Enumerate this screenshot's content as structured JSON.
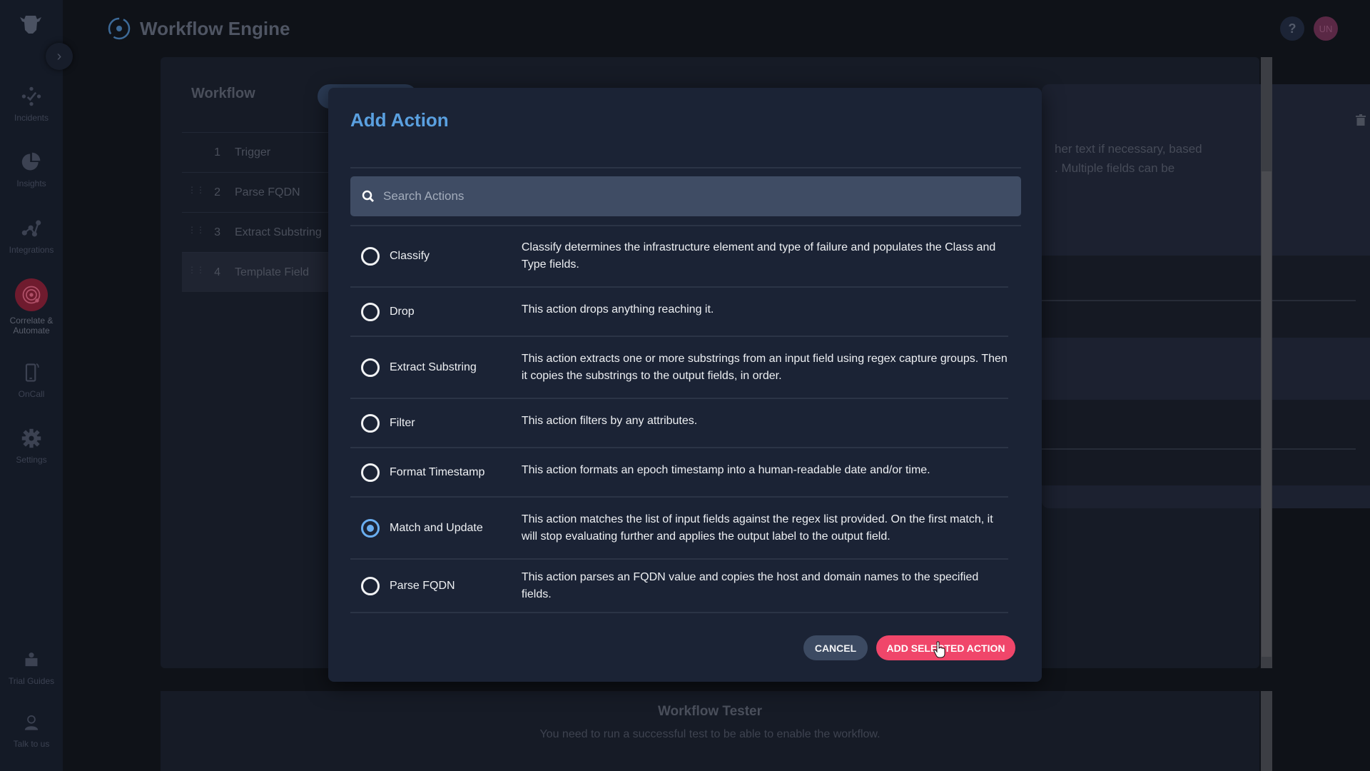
{
  "app": {
    "title": "Workflow Engine",
    "help_label": "?",
    "avatar_initials": "UN"
  },
  "sidebar": {
    "items": [
      {
        "label": "Incidents",
        "icon": "incidents-icon"
      },
      {
        "label": "Insights",
        "icon": "pie-chart-icon"
      },
      {
        "label": "Integrations",
        "icon": "integrations-icon"
      },
      {
        "label": "Correlate & Automate",
        "icon": "radar-icon",
        "active": true
      },
      {
        "label": "OnCall",
        "icon": "phone-icon"
      },
      {
        "label": "Settings",
        "icon": "gear-icon"
      },
      {
        "label": "Trial Guides",
        "icon": "book-icon"
      },
      {
        "label": "Talk to us",
        "icon": "support-agent-icon"
      }
    ]
  },
  "workflow": {
    "title": "Workflow",
    "steps": [
      {
        "num": "1",
        "label": "Trigger"
      },
      {
        "num": "2",
        "label": "Parse FQDN"
      },
      {
        "num": "3",
        "label": "Extract Substring"
      },
      {
        "num": "4",
        "label": "Template Field"
      }
    ],
    "detail_text_line1": "her text if necessary, based",
    "detail_text_line2": ". Multiple fields can be"
  },
  "tester": {
    "title": "Workflow Tester",
    "message": "You need to run a successful test to be able to enable the workflow."
  },
  "modal": {
    "title": "Add Action",
    "search_placeholder": "Search Actions",
    "search_value": "",
    "actions": [
      {
        "name": "Classify",
        "description": "Classify determines the infrastructure element and type of failure and populates the Class and Type fields.",
        "selected": false
      },
      {
        "name": "Drop",
        "description": "This action drops anything reaching it.",
        "selected": false
      },
      {
        "name": "Extract Substring",
        "description": "This action extracts one or more substrings from an input field using regex capture groups. Then it copies the substrings to the output fields, in order.",
        "selected": false
      },
      {
        "name": "Filter",
        "description": "This action filters by any attributes.",
        "selected": false
      },
      {
        "name": "Format Timestamp",
        "description": "This action formats an epoch timestamp into a human-readable date and/or time.",
        "selected": false
      },
      {
        "name": "Match and Update",
        "description": "This action matches the list of input fields against the regex list provided. On the first match, it will stop evaluating further and applies the output label to the output field.",
        "selected": true
      },
      {
        "name": "Parse FQDN",
        "description": "This action parses an FQDN value and copies the host and domain names to the specified fields.",
        "selected": false
      }
    ],
    "cancel_label": "CANCEL",
    "add_label": "ADD SELECTED ACTION"
  },
  "colors": {
    "accent_blue": "#5aa0e0",
    "primary_button": "#f0466a",
    "secondary_button": "#3c4a62"
  }
}
